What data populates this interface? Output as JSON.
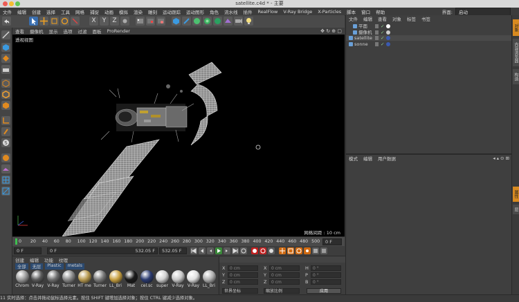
{
  "window": {
    "title": "satellite.c4d * - 主要"
  },
  "menu": {
    "items": [
      "文件",
      "编辑",
      "创建",
      "选择",
      "工具",
      "网格",
      "捕捉",
      "动画",
      "模拟",
      "渲染",
      "雕刻",
      "运动跟踪",
      "运动图形",
      "角色",
      "流水线",
      "插件",
      "RealFlow",
      "V-Ray Bridge",
      "X-Particles",
      "脚本",
      "窗口",
      "帮助"
    ]
  },
  "layout": {
    "label": "界面:",
    "value": "启动"
  },
  "viewport": {
    "menu": [
      "查看",
      "摄像机",
      "显示",
      "选项",
      "过滤",
      "面板",
      "ProRender"
    ],
    "name": "透视视图",
    "grid_info": "网格间距 : 10 cm"
  },
  "timeline": {
    "ticks": [
      "0",
      "20",
      "40",
      "60",
      "80",
      "100",
      "120",
      "140",
      "160",
      "180",
      "200",
      "220",
      "240",
      "260",
      "280",
      "300",
      "320",
      "340",
      "360",
      "380",
      "400",
      "420",
      "440",
      "460",
      "480",
      "500",
      "520"
    ],
    "end_label": "0 F"
  },
  "transport": {
    "start": "0 F",
    "current": "0 F",
    "max": "532.05 F",
    "end": "532.05 F"
  },
  "materials": {
    "menu": [
      "创建",
      "编辑",
      "功能",
      "纹理"
    ],
    "filters": [
      "全部",
      "无层",
      "Plastic",
      "metals"
    ],
    "items": [
      {
        "label": "Chrom",
        "color": "#9a9a9a"
      },
      {
        "label": "V-Ray",
        "color": "#5a5a5a"
      },
      {
        "label": "V-Ray",
        "color": "#6e6e6e"
      },
      {
        "label": "Turner",
        "color": "#8a8a8a"
      },
      {
        "label": "HT me",
        "color": "#b89a50"
      },
      {
        "label": "Turner",
        "color": "#7a7a7a"
      },
      {
        "label": "LL_Bri",
        "color": "#c8a040"
      },
      {
        "label": "Mat",
        "color": "#1a1a1a"
      },
      {
        "label": "cel.sc",
        "color": "#2a3a70"
      },
      {
        "label": "super",
        "color": "#d0d0d0"
      },
      {
        "label": "V-Ray",
        "color": "#c8c8c8"
      },
      {
        "label": "V-Ray",
        "color": "#e0e0e0"
      },
      {
        "label": "LL_Bri",
        "color": "#b0b0b0"
      }
    ]
  },
  "coords": {
    "rows": [
      {
        "a": "X",
        "av": "0 cm",
        "b": "X",
        "bv": "0 cm",
        "c": "H",
        "cv": "0 °"
      },
      {
        "a": "Y",
        "av": "0 cm",
        "b": "Y",
        "bv": "0 cm",
        "c": "P",
        "cv": "0 °"
      },
      {
        "a": "Z",
        "av": "0 cm",
        "b": "Z",
        "bv": "0 cm",
        "c": "B",
        "cv": "0 °"
      }
    ],
    "mode1": "世界坐标",
    "mode2": "缩放比例",
    "apply": "应用"
  },
  "objects": {
    "menu": [
      "文件",
      "编辑",
      "查看",
      "对象",
      "标签",
      "书签"
    ],
    "items": [
      {
        "name": "平面",
        "indent": 1
      },
      {
        "name": "摄像机",
        "indent": 1
      },
      {
        "name": "satellite",
        "indent": 0
      },
      {
        "name": "sonne",
        "indent": 0
      }
    ]
  },
  "attributes": {
    "menu": [
      "模式",
      "编辑",
      "用户数据"
    ]
  },
  "right_tabs": [
    "对象",
    "内容浏览器",
    "构造",
    "层",
    "属性"
  ],
  "status": "11 实时选择：点击并拖动鼠标选择元素。按住 SHIFT 键增加选择对象；按住 CTRL 键减少选择对象。",
  "colors": {
    "accent": "#3a6fb0",
    "orange": "#e07a1a",
    "viewport_bg": "#000000"
  }
}
